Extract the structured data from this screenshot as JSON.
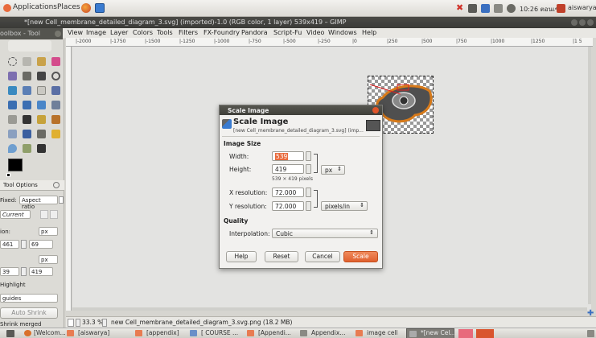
{
  "system_panel": {
    "applications": "Applications",
    "places": "Places",
    "time": "10:26 ตอนเช้า",
    "user": "aiswarya"
  },
  "window": {
    "title": "*[new Cell_membrane_detailed_diagram_3.svg] (imported)-1.0 (RGB color, 1 layer) 539x419 – GIMP"
  },
  "toolbox_title": "oolbox - Tool",
  "menu": [
    "View",
    "Image",
    "Layer",
    "Colors",
    "Tools",
    "Filters",
    "FX-Foundry",
    "Pandora",
    "Script-Fu",
    "Video",
    "Windows",
    "Help"
  ],
  "ruler_labels": [
    "|-2000",
    "|-1750",
    "|-1500",
    "|-1250",
    "|-1000",
    "|-750",
    "|-500",
    "|-250",
    "|0",
    "|250",
    "|500",
    "|750",
    "|1000",
    "|1250",
    "|1 5"
  ],
  "tool_options": {
    "title": "Tool Options",
    "fixed_label": "Fixed:",
    "fixed_value": "Aspect ratio",
    "current": "Current",
    "position_label": "ion:",
    "position_unit": "px",
    "pos_x": "461",
    "pos_y": "69",
    "size_unit": "px",
    "size_w": "39",
    "size_h": "419",
    "highlight": "Highlight",
    "guides": "guides",
    "auto_shrink": "Auto Shrink",
    "shrink_merged": "Shrink merged"
  },
  "status_bar": {
    "zoom": "33.3 %",
    "info": "new Cell_membrane_detailed_diagram_3.svg.png (18.2 MB)"
  },
  "dialog": {
    "window_title": "Scale Image",
    "heading": "Scale Image",
    "subheading": "[new Cell_membrane_detailed_diagram_3.svg] (imp...",
    "image_size_label": "Image Size",
    "width_label": "Width:",
    "width_value": "539",
    "height_label": "Height:",
    "height_value": "419",
    "size_unit": "px",
    "size_hint": "539 × 419 pixels",
    "xres_label": "X resolution:",
    "xres_value": "72.000",
    "yres_label": "Y resolution:",
    "yres_value": "72.000",
    "res_unit": "pixels/in",
    "quality_label": "Quality",
    "interp_label": "Interpolation:",
    "interp_value": "Cubic",
    "buttons": {
      "help": "Help",
      "reset": "Reset",
      "cancel": "Cancel",
      "scale": "Scale"
    }
  },
  "taskbar": [
    "[Welcom...",
    "[aiswarya]",
    "[appendix]",
    "[ COURSE ...",
    "[Appendi...",
    "Appendix...",
    "image cell",
    "*[new Cel..."
  ],
  "colors": {
    "accent": "#e86a3c",
    "titlebar": "#3f3f3a",
    "canvas": "#e3e3e1"
  }
}
